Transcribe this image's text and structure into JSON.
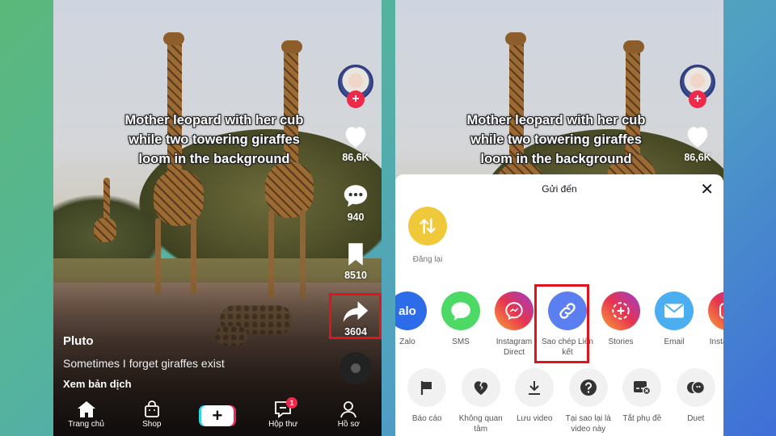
{
  "colors": {
    "highlight": "#e0141c",
    "follow": "#ee2a4a",
    "repost": "#f0c93a",
    "copy_link": "#5b7ff0",
    "sms": "#4cd964",
    "email": "#4aaef0",
    "zalo": "#2d6ce8"
  },
  "video": {
    "caption": "Mother leopard with her cub while two towering giraffes loom in the background",
    "username": "Pluto",
    "description": "Sometimes I forget giraffes exist",
    "translate_label": "Xem bản dịch"
  },
  "rail": {
    "likes": "86,6K",
    "comments": "940",
    "saves": "8510",
    "shares": "3604",
    "follow_symbol": "+"
  },
  "nav": {
    "items": [
      {
        "label": "Trang chủ",
        "icon": "home-icon"
      },
      {
        "label": "Shop",
        "icon": "shop-bag-icon"
      },
      {
        "label": "",
        "icon": "create-plus-icon"
      },
      {
        "label": "Hộp thư",
        "icon": "inbox-icon",
        "badge": "1"
      },
      {
        "label": "Hồ sơ",
        "icon": "profile-icon"
      }
    ],
    "create_symbol": "+"
  },
  "share_sheet": {
    "title": "Gửi đến",
    "close_symbol": "✕",
    "repost": {
      "label": "Đăng lại",
      "icon": "repost-icon"
    },
    "share_targets": [
      {
        "label": "Zalo",
        "icon": "zalo-icon",
        "text": "alo"
      },
      {
        "label": "SMS",
        "icon": "sms-icon"
      },
      {
        "label": "Instagram Direct",
        "icon": "messenger-icon"
      },
      {
        "label": "Sao chép Liên kết",
        "icon": "link-icon"
      },
      {
        "label": "Stories",
        "icon": "stories-icon"
      },
      {
        "label": "Email",
        "icon": "email-icon"
      },
      {
        "label": "Instagram",
        "icon": "instagram-icon"
      }
    ],
    "actions": [
      {
        "label": "Báo cáo",
        "icon": "flag-icon"
      },
      {
        "label": "Không quan tâm",
        "icon": "broken-heart-icon"
      },
      {
        "label": "Lưu video",
        "icon": "download-icon"
      },
      {
        "label": "Tại sao lại là video này",
        "icon": "question-icon"
      },
      {
        "label": "Tắt phụ đề",
        "icon": "captions-off-icon"
      },
      {
        "label": "Duet",
        "icon": "duet-icon"
      }
    ]
  }
}
